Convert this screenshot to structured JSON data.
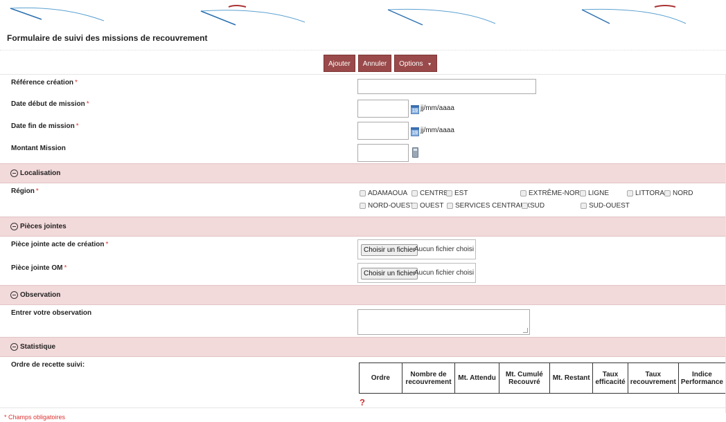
{
  "page": {
    "title": "Formulaire de suivi des missions de recouvrement",
    "footnote": "* Champs obligatoires"
  },
  "toolbar": {
    "add_label": "Ajouter",
    "cancel_label": "Annuler",
    "options_label": "Options",
    "options_caret": "▼"
  },
  "fields": {
    "reference": {
      "label": "Référence création",
      "required": "*",
      "value": ""
    },
    "date_debut": {
      "label": "Date début de mission",
      "required": "*",
      "value": "",
      "format": "jj/mm/aaaa"
    },
    "date_fin": {
      "label": "Date fin de mission",
      "required": "*",
      "value": "",
      "format": "jj/mm/aaaa"
    },
    "montant": {
      "label": "Montant Mission",
      "value": ""
    }
  },
  "sections": {
    "localisation": "Localisation",
    "pieces": "Pièces jointes",
    "observation": "Observation",
    "statistique": "Statistique"
  },
  "region": {
    "label": "Région",
    "required": "*",
    "options": [
      "ADAMAOUA",
      "CENTRE",
      "EST",
      "EXTRÊME-NORD",
      "LIGNE",
      "LITTORAL",
      "NORD",
      "NORD-OUEST",
      "OUEST",
      "SERVICES CENTRAUX",
      "SUD",
      "SUD-OUEST"
    ]
  },
  "attachments": {
    "acte": {
      "label": "Pièce jointe acte de création",
      "required": "*",
      "button": "Choisir un fichier",
      "status": "Aucun fichier choisi"
    },
    "om": {
      "label": "Pièce jointe OM",
      "required": "*",
      "button": "Choisir un fichier",
      "status": "Aucun fichier choisi"
    }
  },
  "observation": {
    "label": "Entrer votre observation",
    "value": ""
  },
  "statistique": {
    "label": "Ordre de recette suivi:",
    "columns": [
      "Ordre",
      "Nombre de recouvrement",
      "Mt. Attendu",
      "Mt. Cumulé Recouvré",
      "Mt. Restant",
      "Taux efficacité",
      "Taux recouvrement",
      "Indice Performance"
    ],
    "help": "?"
  },
  "colors": {
    "accent": "#9a4a4a",
    "section_bg": "#f2d9da",
    "required": "#dd3333"
  }
}
